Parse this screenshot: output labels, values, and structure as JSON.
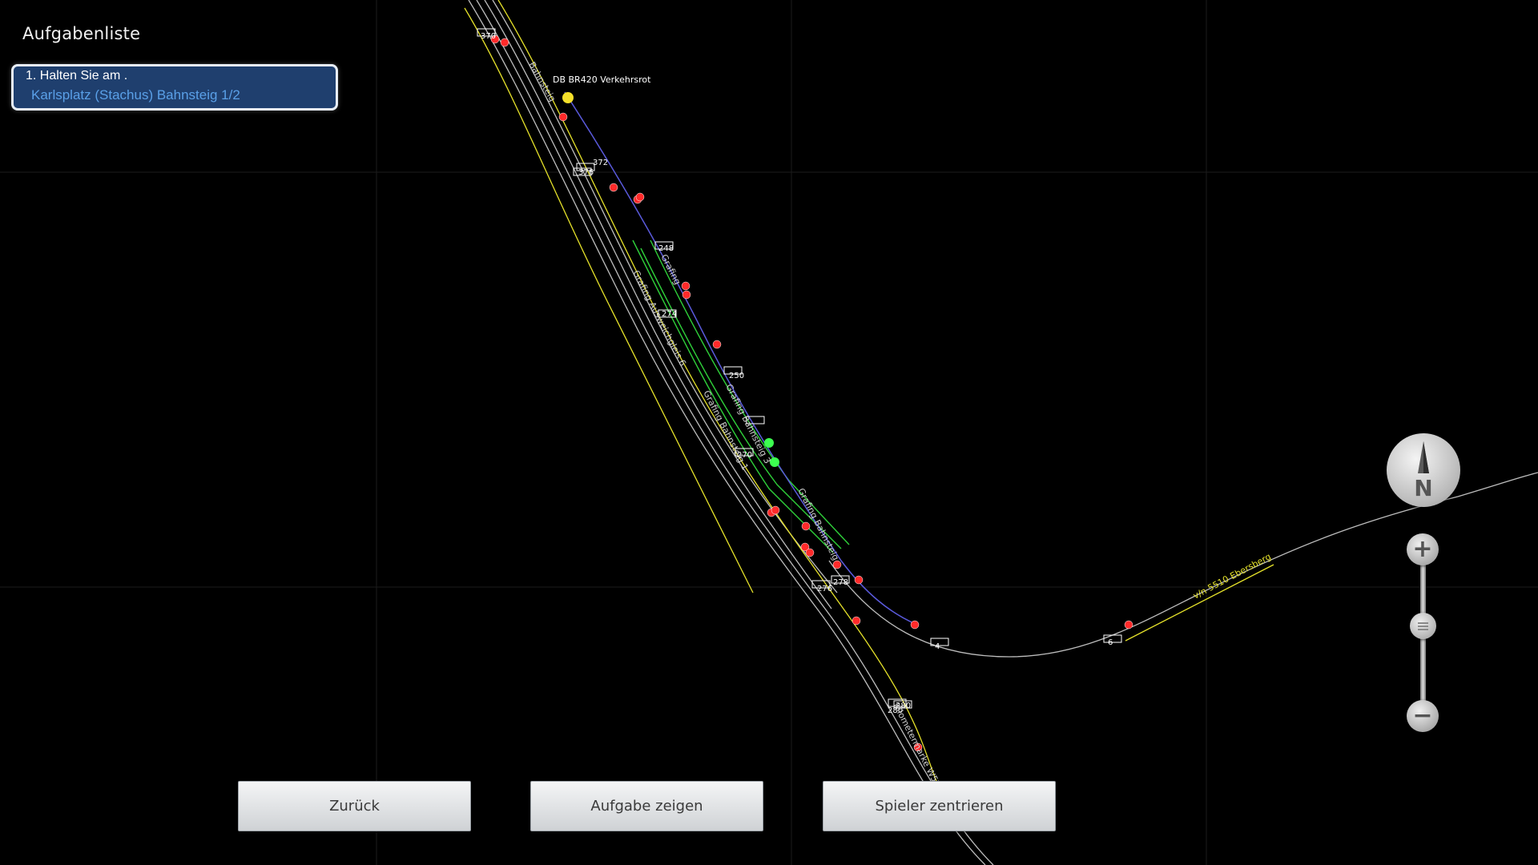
{
  "task_panel": {
    "title": "Aufgabenliste",
    "task_line1": "1. Halten Sie am .",
    "task_line2": "Karlsplatz (Stachus) Bahnsteig 1/2"
  },
  "map": {
    "train_label": "DB BR420 Verkehrsrot",
    "track_labels": {
      "ebersberg": "v/n 5510 Ebersberg",
      "ausweichgleis": "Grafing Ausweichgleis 6",
      "bahnsteig_a": "Grafing Bahnsteig 1",
      "bahnsteig_b": "Grafing Bahnsteig 3",
      "bahnsteig_c": "Grafing Bahnsteig",
      "kilo": "Kilometermarke W52",
      "top_a": "Bahnsteig",
      "mid_a": "Grafing"
    },
    "markers": [
      "370",
      "376",
      "372",
      "374",
      "248",
      "274",
      "250",
      "270",
      "270",
      "278",
      "276",
      "276",
      "4",
      "6",
      "280",
      "280"
    ],
    "colors": {
      "track": "#bdbdbd",
      "yellow": "#e6e22a",
      "green": "#2fd13a",
      "blue": "#5a5adc",
      "signal_red": "#ff2a2a",
      "signal_green": "#3cff50",
      "grid": "#1e1e1e"
    }
  },
  "controls": {
    "compass_label": "N",
    "zoom_in": "+",
    "zoom_out": "−"
  },
  "buttons": {
    "back": "Zurück",
    "show_task": "Aufgabe zeigen",
    "center_player": "Spieler zentrieren"
  }
}
